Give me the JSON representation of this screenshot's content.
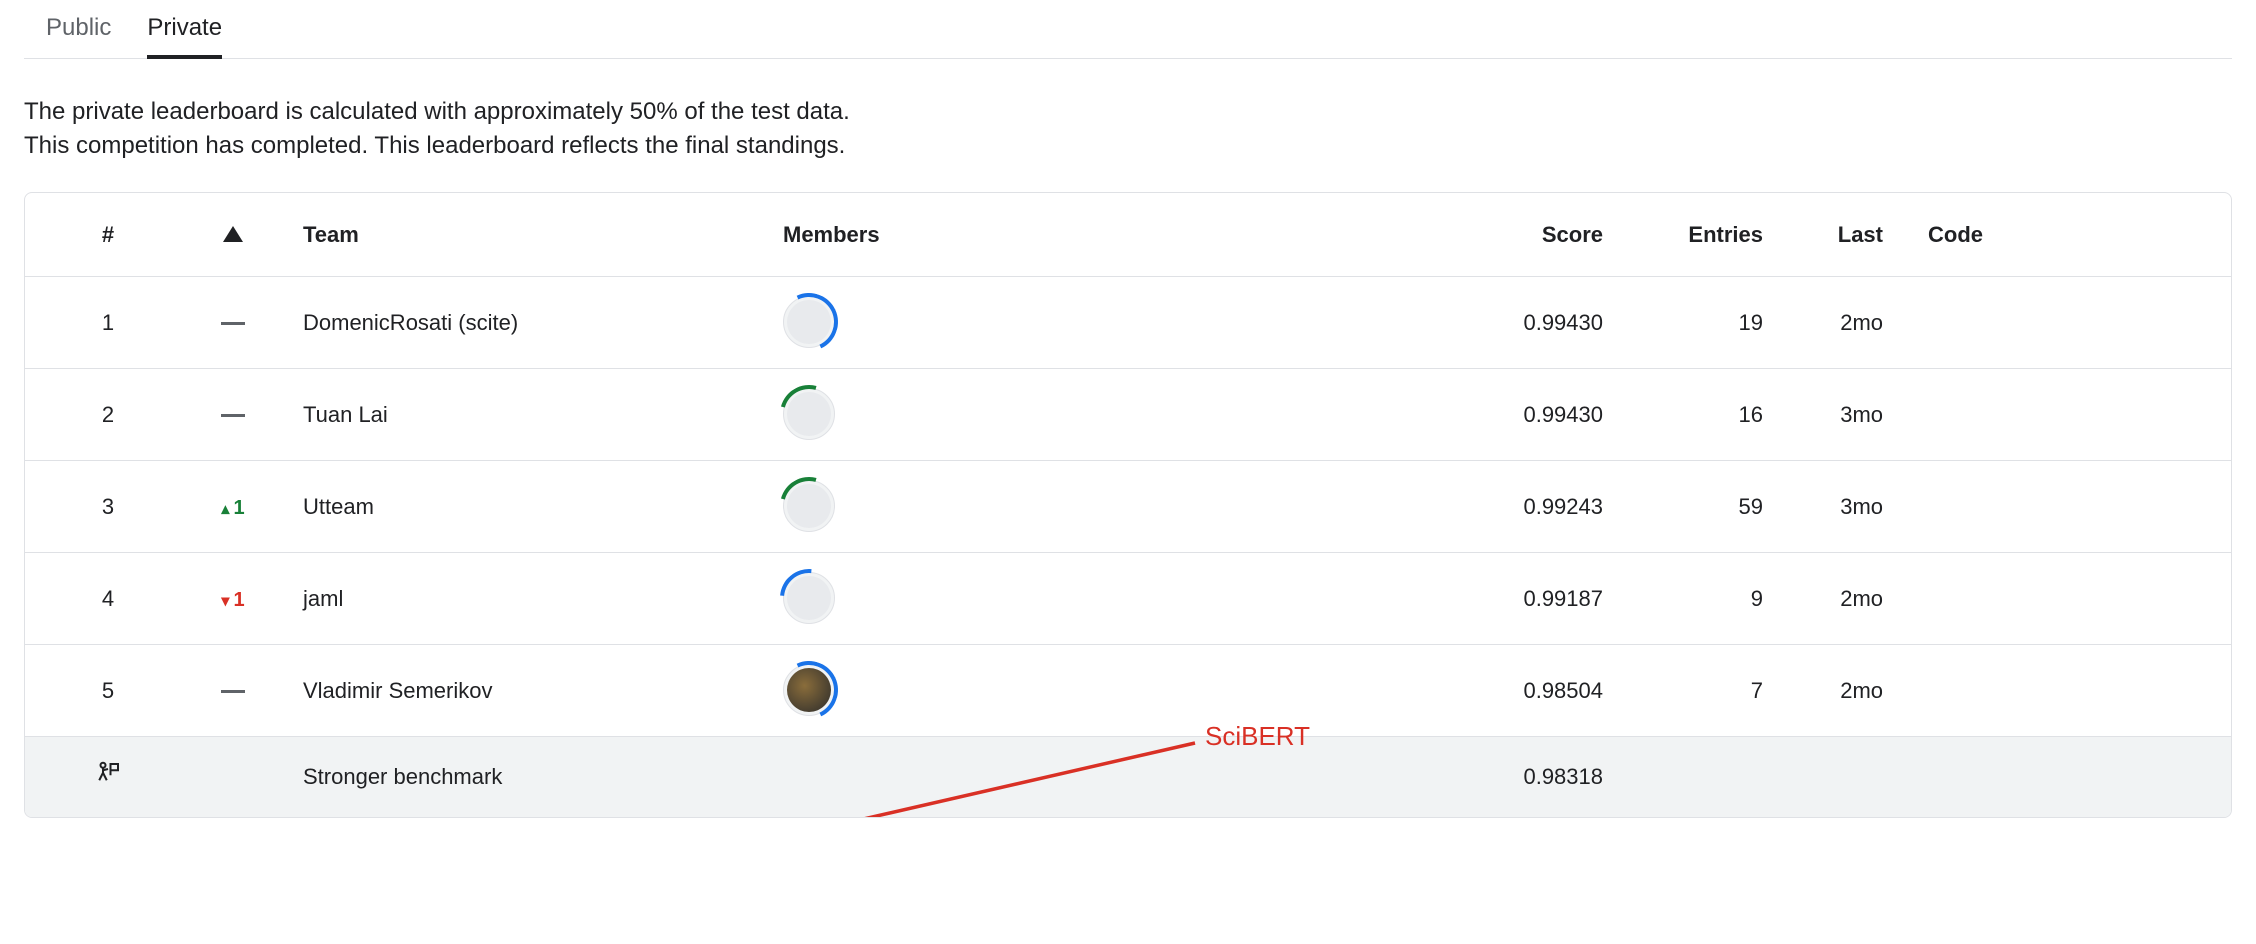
{
  "tabs": {
    "public": "Public",
    "private": "Private",
    "activeIndex": 1
  },
  "description": {
    "line1": "The private leaderboard is calculated with approximately 50% of the test data.",
    "line2": "This competition has completed. This leaderboard reflects the final standings."
  },
  "headers": {
    "rank": "#",
    "delta": "△",
    "team": "Team",
    "members": "Members",
    "score": "Score",
    "entries": "Entries",
    "last": "Last",
    "code": "Code"
  },
  "rows": [
    {
      "rank": "1",
      "deltaType": "dash",
      "delta": "",
      "team": "DomenicRosati (scite)",
      "score": "0.99430",
      "entries": "19",
      "last": "2mo",
      "ring": "blue"
    },
    {
      "rank": "2",
      "deltaType": "dash",
      "delta": "",
      "team": "Tuan Lai",
      "score": "0.99430",
      "entries": "16",
      "last": "3mo",
      "ring": "green"
    },
    {
      "rank": "3",
      "deltaType": "up",
      "delta": "1",
      "team": "Utteam",
      "score": "0.99243",
      "entries": "59",
      "last": "3mo",
      "ring": "green"
    },
    {
      "rank": "4",
      "deltaType": "down",
      "delta": "1",
      "team": "jaml",
      "score": "0.99187",
      "entries": "9",
      "last": "2mo",
      "ring": "blue-top"
    },
    {
      "rank": "5",
      "deltaType": "dash",
      "delta": "",
      "team": "Vladimir Semerikov",
      "score": "0.98504",
      "entries": "7",
      "last": "2mo",
      "ring": "blue",
      "dark": true
    }
  ],
  "benchmark": {
    "team": "Stronger benchmark",
    "score": "0.98318"
  },
  "annotation": {
    "label": "SciBERT"
  },
  "colors": {
    "up": "#188038",
    "down": "#d93025",
    "accent": "#1a73e8"
  }
}
